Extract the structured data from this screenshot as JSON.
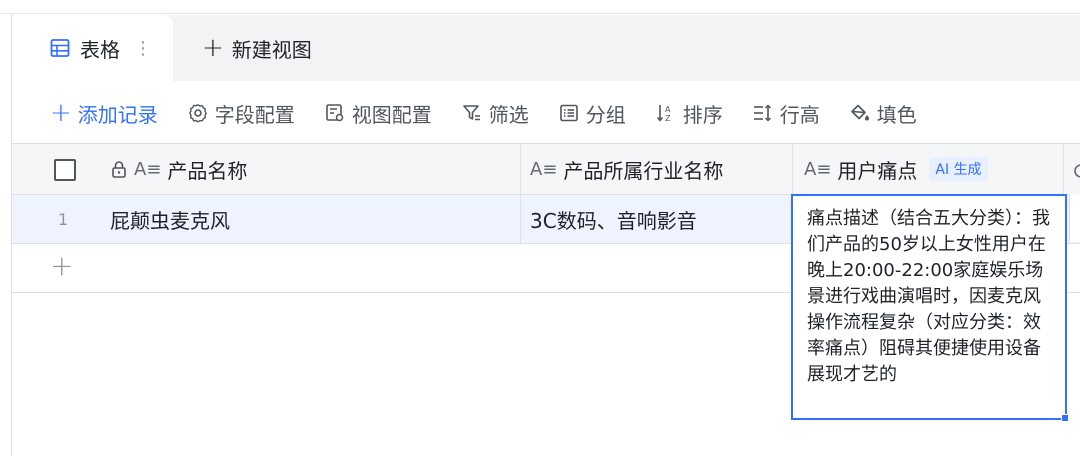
{
  "tabs": {
    "active_label": "表格",
    "more_glyph": "⋮",
    "new_view_label": "新建视图"
  },
  "toolbar": {
    "add_record": "添加记录",
    "field_config": "字段配置",
    "view_config": "视图配置",
    "filter": "筛选",
    "group": "分组",
    "sort": "排序",
    "row_height": "行高",
    "fill_color": "填色"
  },
  "columns": {
    "col1": "产品名称",
    "col2": "产品所属行业名称",
    "col3": "用户痛点",
    "col3_tag": "AI 生成",
    "text_type_glyph": "A≡"
  },
  "rows": [
    {
      "index": "1",
      "product": "屁颠虫麦克风",
      "industry": "3C数码、音响影音",
      "pain_point": "痛点描述（结合五大分类）：我们产品的50岁以上女性用户在晚上20:00-22:00家庭娱乐场景进行戏曲演唱时，因麦克风操作流程复杂（对应分类：效率痛点）阻碍其便捷使用设备展现才艺的"
    }
  ],
  "colors": {
    "accent": "#3370ff",
    "selected_row": "#eef3fe",
    "border": "#dee0e3"
  }
}
